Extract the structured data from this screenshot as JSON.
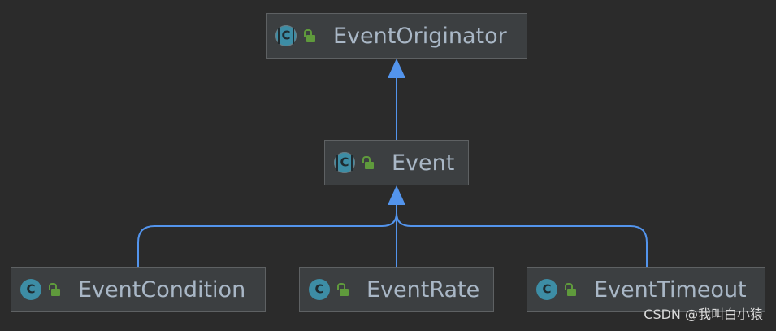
{
  "diagram": {
    "nodes": {
      "event_originator": {
        "name": "EventOriginator",
        "kind": "abstract-class",
        "visibility": "public"
      },
      "event": {
        "name": "Event",
        "kind": "abstract-class",
        "visibility": "public"
      },
      "event_condition": {
        "name": "EventCondition",
        "kind": "class",
        "visibility": "public"
      },
      "event_rate": {
        "name": "EventRate",
        "kind": "class",
        "visibility": "public"
      },
      "event_timeout": {
        "name": "EventTimeout",
        "kind": "class",
        "visibility": "public"
      }
    },
    "edges": [
      {
        "from": "Event",
        "to": "EventOriginator",
        "type": "extends"
      },
      {
        "from": "EventCondition",
        "to": "Event",
        "type": "extends"
      },
      {
        "from": "EventRate",
        "to": "Event",
        "type": "extends"
      },
      {
        "from": "EventTimeout",
        "to": "Event",
        "type": "extends"
      }
    ],
    "icons": {
      "class": "class-icon",
      "visibility": "unlocked-lock-icon"
    },
    "colors": {
      "background": "#2b2b2b",
      "node_fill": "#3c3f41",
      "node_text": "#a9b7c6",
      "edge": "#5394ec",
      "class_icon": "#3d8da5",
      "lock_icon": "#5f9a3c"
    }
  },
  "watermark": "CSDN @我叫白小猿"
}
